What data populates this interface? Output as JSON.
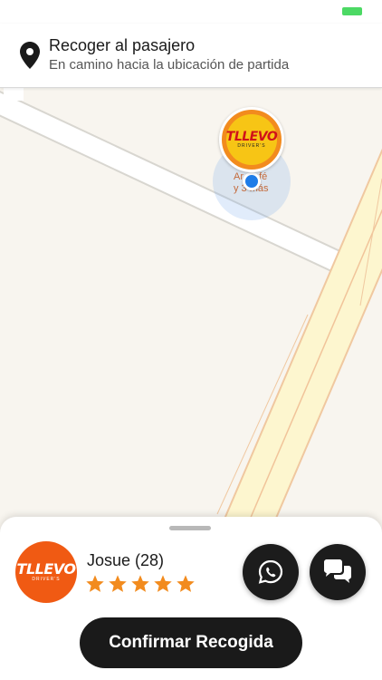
{
  "header": {
    "title": "Recoger al pasajero",
    "subtitle": "En camino hacia la ubicación de partida",
    "icon": "location-pin-icon"
  },
  "map": {
    "poi_label_line1": "Ar  Café",
    "poi_label_line2": "y  3 más",
    "marker_logo": "TLLEVO",
    "marker_logo_sub": "DRIVER'S"
  },
  "driver": {
    "name": "Josue (28)",
    "rating_stars": 5,
    "avatar_logo": "TLLEVO",
    "avatar_logo_sub": "DRIVER'S"
  },
  "actions": {
    "whatsapp_icon": "whatsapp-icon",
    "chat_icon": "chat-bubbles-icon",
    "confirm_label": "Confirmar Recogida"
  },
  "colors": {
    "accent": "#f28b1e",
    "button_dark": "#1a1a1a",
    "star": "#f28b1e",
    "location_dot": "#1e7ce8",
    "battery": "#4cd964"
  }
}
